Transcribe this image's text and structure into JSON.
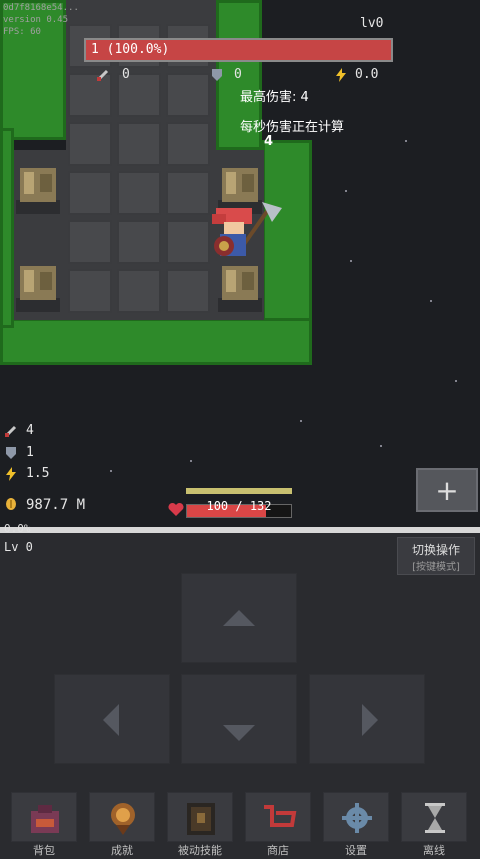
{
  "debug": {
    "id": "0d7f8168e54...",
    "version": "version 0.45",
    "fps": "FPS: 60"
  },
  "hud": {
    "level": "lv0",
    "boss_hp": "1 (100.0%)",
    "attack": "0",
    "defense": "0",
    "speed": "0.0",
    "max_damage": "最高伤害: 4",
    "dps": "每秒伤害正在计算",
    "damage_float": "4"
  },
  "player": {
    "attack": "4",
    "defense": "1",
    "speed": "1.5",
    "gold": "987.7 M",
    "hp_text": "100 / 132",
    "hp_fraction": 0.76
  },
  "exp": {
    "percent": "0.0%",
    "level": "Lv 0"
  },
  "switch_button": {
    "title": "切换操作",
    "subtitle": "[按键模式]"
  },
  "nav": [
    {
      "label": "背包"
    },
    {
      "label": "成就"
    },
    {
      "label": "被动技能"
    },
    {
      "label": "商店"
    },
    {
      "label": "设置"
    },
    {
      "label": "离线"
    }
  ],
  "colors": {
    "grass": "#2e8a2a",
    "bossbar": "#c64545",
    "hp": "#d94646",
    "gold": "#e8b23a"
  }
}
